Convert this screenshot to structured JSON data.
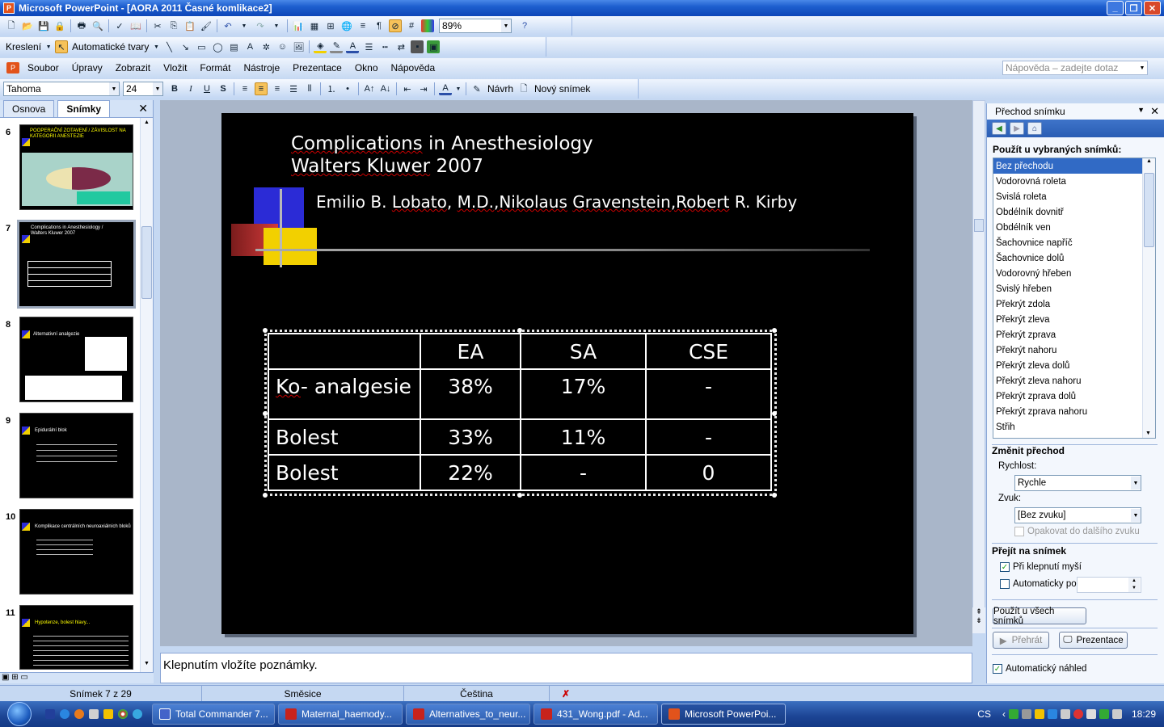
{
  "window": {
    "title": "Microsoft PowerPoint - [AORA 2011 Časné komlikace2]",
    "app_icon_letter": "P"
  },
  "toolbar_std": {
    "zoom": "89%"
  },
  "toolbar_draw": {
    "draw_label": "Kreslení",
    "autoshapes_label": "Automatické tvary"
  },
  "menu": {
    "items": [
      "Soubor",
      "Úpravy",
      "Zobrazit",
      "Vložit",
      "Formát",
      "Nástroje",
      "Prezentace",
      "Okno",
      "Nápověda"
    ],
    "help_placeholder": "Nápověda – zadejte dotaz"
  },
  "format_toolbar": {
    "font": "Tahoma",
    "size": "24",
    "bold": "B",
    "italic": "I",
    "underline": "U",
    "shadow": "S",
    "design_label": "Návrh",
    "new_slide_label": "Nový snímek"
  },
  "left_panel": {
    "tab_outline": "Osnova",
    "tab_slides": "Snímky",
    "thumbs": [
      {
        "num": "6",
        "text": "POOPERAČNÍ ZOTAVENÍ / ZÁVISLOST NA KATEGORII ANESTEZIE"
      },
      {
        "num": "7",
        "text": "Complications in Anesthesiology / Walters Kluwer 2007"
      },
      {
        "num": "8",
        "text": "Alternativní analgezie"
      },
      {
        "num": "9",
        "text": "Epidurální blok"
      },
      {
        "num": "10",
        "text": "Komplikace centrálních neuroaxiálních bloků"
      },
      {
        "num": "11",
        "text": "Hypotenze, bolest hlavy..."
      }
    ]
  },
  "slide": {
    "title_line1_a": "Complications",
    "title_line1_b": " in Anesthesiology",
    "title_line2_a": "Walters Kluwer",
    "title_line2_b": " 2007",
    "authors_a": "Emilio B. ",
    "authors_b": "Lobato",
    "authors_c": ", ",
    "authors_d": "M.D.,Nikolaus",
    "authors_e": " ",
    "authors_f": "Gravenstein,Robert",
    "authors_g": " R. Kirby",
    "table": {
      "headers": [
        "",
        "EA",
        "SA",
        "CSE"
      ],
      "rows": [
        {
          "label_a": "Ko",
          "label_b": "- analgesie",
          "values": [
            "38%",
            "17%",
            "-"
          ]
        },
        {
          "label_a": "Bolest",
          "label_b": "",
          "values": [
            "33%",
            "11%",
            "-"
          ]
        },
        {
          "label_a": "Bolest",
          "label_b": "",
          "values": [
            "22%",
            "-",
            "0"
          ]
        }
      ]
    }
  },
  "notes": {
    "placeholder": "Klepnutím vložíte poznámky."
  },
  "task_pane": {
    "title": "Přechod snímku",
    "apply_header": "Použít u vybraných snímků:",
    "transitions": [
      "Bez přechodu",
      "Vodorovná roleta",
      "Svislá roleta",
      "Obdélník dovnitř",
      "Obdélník ven",
      "Šachovnice napříč",
      "Šachovnice dolů",
      "Vodorovný hřeben",
      "Svislý hřeben",
      "Překrýt zdola",
      "Překrýt zleva",
      "Překrýt zprava",
      "Překrýt nahoru",
      "Překrýt zleva dolů",
      "Překrýt zleva nahoru",
      "Překrýt zprava dolů",
      "Překrýt zprava nahoru",
      "Střih"
    ],
    "modify_header": "Změnit přechod",
    "speed_label": "Rychlost:",
    "speed_value": "Rychle",
    "sound_label": "Zvuk:",
    "sound_value": "[Bez zvuku]",
    "loop_label": "Opakovat do dalšího zvuku",
    "advance_header": "Přejít na snímek",
    "on_click_label": "Při klepnutí myší",
    "auto_label": "Automaticky po",
    "apply_all_button": "Použít u všech snímků",
    "play_button": "Přehrát",
    "slideshow_button": "Prezentace",
    "autopreview_label": "Automatický náhled"
  },
  "status": {
    "slide": "Snímek 7 z 29",
    "design": "Směsice",
    "language": "Čeština"
  },
  "taskbar": {
    "items": [
      "Total Commander 7...",
      "Maternal_haemody...",
      "Alternatives_to_neur...",
      "431_Wong.pdf - Ad...",
      "Microsoft PowerPoi..."
    ],
    "lang": "CS",
    "time": "18:29"
  },
  "colors": {
    "accent": "#316ac5",
    "slide_bg": "#000000",
    "deco_blue": "#2b2bd6",
    "deco_red": "#d23a3a",
    "deco_yellow": "#f2d000"
  }
}
